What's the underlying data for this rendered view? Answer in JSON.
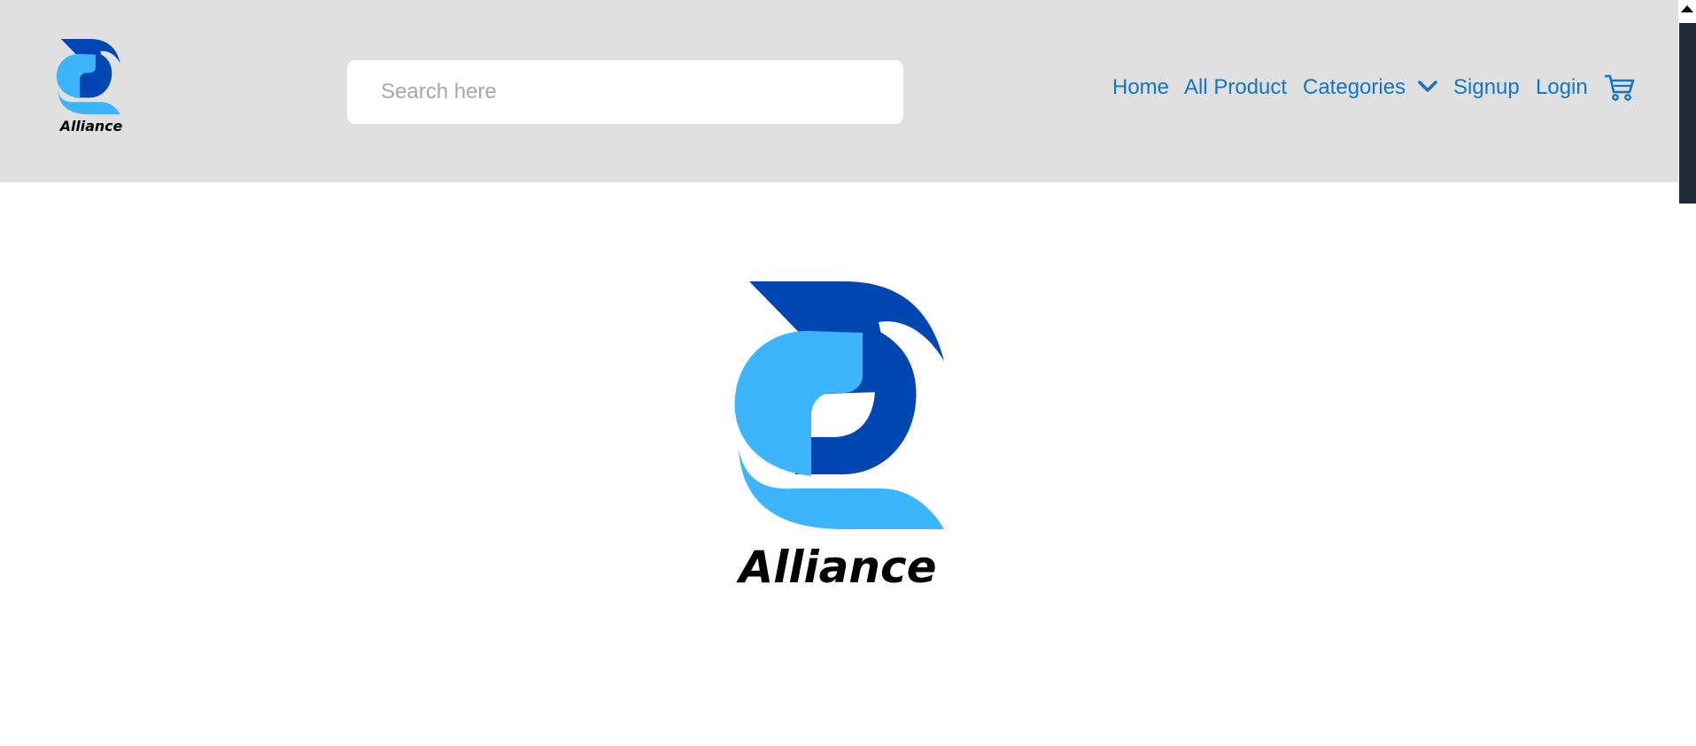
{
  "brand": {
    "name": "Alliance",
    "colors": {
      "dark_blue": "#0247b1",
      "light_blue": "#3db5fd",
      "wordmark": "#000000"
    }
  },
  "header": {
    "background": "#e0e0e0",
    "search": {
      "placeholder": "Search here",
      "value": ""
    },
    "nav": {
      "home": "Home",
      "all_product": "All Product",
      "categories": "Categories",
      "signup": "Signup",
      "login": "Login",
      "link_color": "#1775c0",
      "categories_icon": "chevron-down-icon",
      "cart_icon": "cart-icon"
    }
  },
  "scrollbar": {
    "thumb_color": "#1f2a37",
    "up_icon": "scroll-up-arrow-icon"
  }
}
